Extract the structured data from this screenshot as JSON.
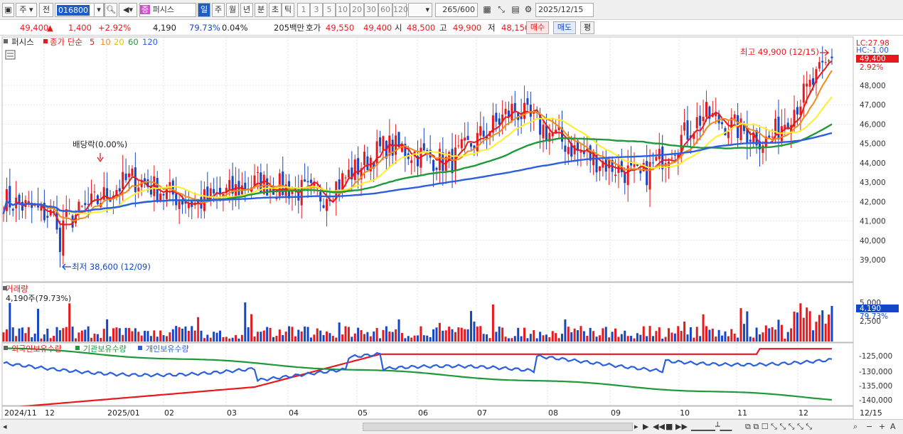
{
  "toolbar": {
    "market_type": "주",
    "all_label": "전",
    "stock_code": "016800",
    "stock_name": "퍼시스",
    "period_tabs": [
      "일",
      "주",
      "월",
      "년",
      "분",
      "초",
      "틱"
    ],
    "active_period": "일",
    "interval_buttons": [
      "1",
      "3",
      "5",
      "10",
      "20",
      "30",
      "60",
      "120"
    ],
    "count": "265",
    "count_total": "/600",
    "date": "2025/12/15"
  },
  "quote": {
    "price": "49,400",
    "change": "1,400",
    "change_pct": "+2.92%",
    "volume": "4,190",
    "volume_ratio": "79.73%",
    "turnover": "0.04%",
    "amount": "205백만",
    "hoga_label": "호가",
    "ask": "49,550",
    "bid": "49,400",
    "open_label": "시",
    "open": "48,500",
    "high_label": "고",
    "high": "49,900",
    "low_label": "저",
    "low": "48,150",
    "buy_label": "매수",
    "sell_label": "매도",
    "eval_label": "평"
  },
  "price_panel": {
    "name": "퍼시스",
    "ma_label": "종가 단순",
    "ma_periods": [
      "5",
      "10",
      "20",
      "60",
      "120"
    ],
    "ma_colors": [
      "#e8191d",
      "#f08a1a",
      "#ffee2a",
      "#1f9a3a",
      "#2b5fe0"
    ],
    "lc": "LC:27.98",
    "hc": "HC:-1.00",
    "last_price_tag": "49,400",
    "last_pct_tag": "2.92%",
    "high_note": "최고 49,900 (12/15)",
    "low_note": "최저 38,600 (12/09)",
    "dividend_note": "배당락(0.00%)",
    "y_ticks": [
      "48,000",
      "47,000",
      "46,000",
      "45,000",
      "44,000",
      "43,000",
      "42,000",
      "41,000",
      "40,000",
      "39,000"
    ]
  },
  "volume_panel": {
    "title": "거래량",
    "current": "4,190주(79.73%)",
    "y_ticks": [
      "5,000",
      "2,500"
    ],
    "tag_value": "4,190",
    "tag_pct": "79.73%"
  },
  "holding_panel": {
    "legend": [
      "외국인보유수량",
      "기관보유수량",
      "개인보유수량"
    ],
    "colors": [
      "#e8191d",
      "#1f9a3a",
      "#2b5fe0"
    ],
    "y_ticks": [
      "-125,000",
      "-130,000",
      "-135,000",
      "-140,000"
    ]
  },
  "x_axis": [
    "2024/11",
    "12",
    "2025/01",
    "02",
    "03",
    "04",
    "05",
    "06",
    "07",
    "08",
    "09",
    "10",
    "11",
    "12",
    "12/15"
  ],
  "chart_data": {
    "type": "candlestick",
    "title": "퍼시스",
    "ylim": [
      38000,
      50500
    ],
    "months": [
      "2024/11",
      "12",
      "2025/01",
      "02",
      "03",
      "04",
      "05",
      "06",
      "07",
      "08",
      "09",
      "10",
      "11",
      "12"
    ],
    "close_by_month": [
      42100,
      41000,
      43200,
      41900,
      43000,
      42300,
      44900,
      44000,
      46800,
      44600,
      43200,
      46500,
      45100,
      49400
    ],
    "high": 49900,
    "high_date": "12/15",
    "low": 38600,
    "low_date": "12/09",
    "last_close": 49400
  }
}
